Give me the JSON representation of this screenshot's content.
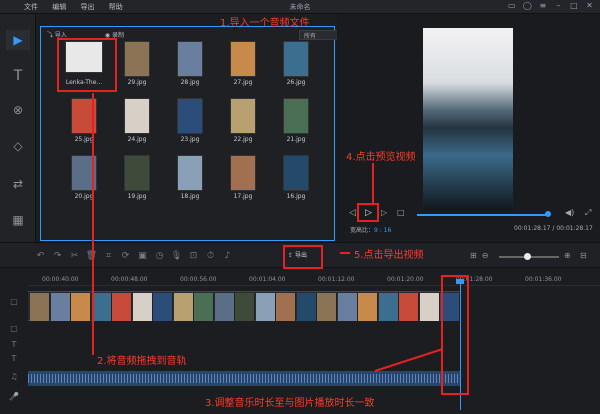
{
  "window": {
    "title": "未命名",
    "menu": [
      "文件",
      "编辑",
      "导出",
      "帮助"
    ]
  },
  "media": {
    "tab_import": "导入",
    "tab_record": "录制",
    "filter": "所有",
    "items": [
      {
        "label": "Lenka-The...",
        "color": "#e8e8e8"
      },
      {
        "label": "29.jpg",
        "color": "#8b7355"
      },
      {
        "label": "28.jpg",
        "color": "#6a7fa0"
      },
      {
        "label": "27.jpg",
        "color": "#c78a4a"
      },
      {
        "label": "26.jpg",
        "color": "#3c6e8f"
      },
      {
        "label": "25.jpg",
        "color": "#c84b3a"
      },
      {
        "label": "24.jpg",
        "color": "#d8d0c6"
      },
      {
        "label": "23.jpg",
        "color": "#2c4d7a"
      },
      {
        "label": "22.jpg",
        "color": "#b8a070"
      },
      {
        "label": "21.jpg",
        "color": "#4b6f55"
      },
      {
        "label": "20.jpg",
        "color": "#5a6e88"
      },
      {
        "label": "19.jpg",
        "color": "#3f4b3a"
      },
      {
        "label": "18.jpg",
        "color": "#8aa0b6"
      },
      {
        "label": "17.jpg",
        "color": "#a07050"
      },
      {
        "label": "16.jpg",
        "color": "#234a6a"
      }
    ]
  },
  "preview": {
    "ratio_label": "宽高比：",
    "ratio_value": "9 : 16",
    "timecode": "00:01:28.17 / 00:01:28.17",
    "progress": 1.0
  },
  "toolbar": {
    "export_label": "导出"
  },
  "ruler": [
    "00:00:40.00",
    "00:00:48.00",
    "00:00:56.00",
    "00:01:04.00",
    "00:01:12.00",
    "00:01:20.00",
    "00:01:28.00",
    "00:01:36.00"
  ],
  "annotations": {
    "step1": "1.导入一个音频文件",
    "step2": "2.将音频拖拽到音轨",
    "step3": "3.调整音乐时长至与图片播放时长一致",
    "step4": "4.点击预览视频",
    "step5": "5.点击导出视频"
  },
  "colors": {
    "accent": "#2f9bff",
    "annotation": "#e52222"
  }
}
